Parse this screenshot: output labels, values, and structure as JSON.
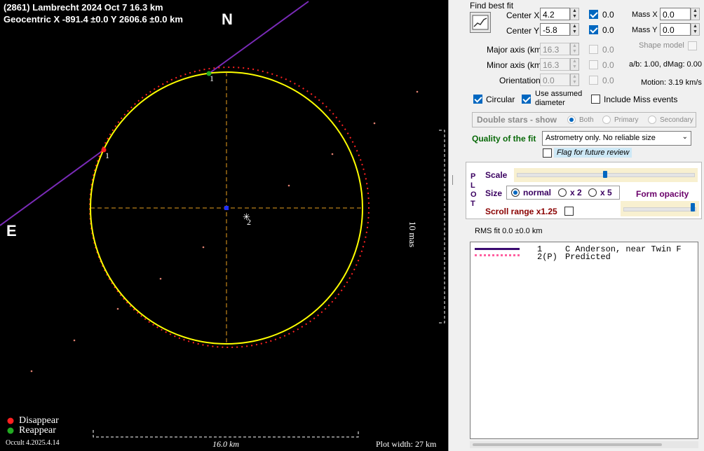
{
  "plot": {
    "title_line1": "(2861) Lambrecht  2024 Oct 7  16.3 km",
    "title_line2": "Geocentric  X  -891.4 ±0.0  Y 2606.6 ±0.0 km",
    "north_label": "N",
    "east_label": "E",
    "chord_marker_label": "1",
    "chord_marker_label_2": "1",
    "star_label": "2",
    "legend_disappear": "Disappear",
    "legend_reappear": "Reappear",
    "version": "Occult 4.2025.4.14",
    "scale_bar_label": "16.0 km",
    "plot_width_label": "Plot width: 27 km",
    "side_scale_label": "10 mas",
    "colors": {
      "ellipse": "#ffff00",
      "predicted": "#ff2020",
      "chord": "#7a2bb8",
      "axes": "#e8a020",
      "disappear": "#ff2020",
      "reappear": "#22aa22"
    }
  },
  "panel": {
    "find_best_fit": "Find best fit",
    "center_x_label": "Center X",
    "center_x_value": "4.2",
    "center_x_check": "0.0",
    "center_y_label": "Center Y",
    "center_y_value": "-5.8",
    "center_y_check": "0.0",
    "mass_x_label": "Mass X",
    "mass_x_value": "0.0",
    "mass_y_label": "Mass Y",
    "mass_y_value": "0.0",
    "shape_model_label": "Shape model",
    "major_axis_label": "Major axis (km)",
    "major_axis_value": "16.3",
    "major_axis_check": "0.0",
    "minor_axis_label": "Minor axis (km)",
    "minor_axis_value": "16.3",
    "minor_axis_check": "0.0",
    "orientation_label": "Orientation",
    "orientation_value": "0.0",
    "orientation_check": "0.0",
    "ab_dmag": "a/b: 1.00, dMag: 0.00",
    "motion": "Motion: 3.19 km/s",
    "circular_label": "Circular",
    "use_assumed_label": "Use assumed",
    "use_assumed_label2": "diameter",
    "include_miss_label": "Include Miss events",
    "double_stars_label": "Double stars - show",
    "both_label": "Both",
    "primary_label": "Primary",
    "secondary_label": "Secondary",
    "quality_label": "Quality of the fit",
    "quality_value": "Astrometry only. No reliable size",
    "flag_label": "Flag for future review",
    "plot_letters": [
      "P",
      "L",
      "O",
      "T"
    ],
    "scale_label": "Scale",
    "size_label": "Size",
    "size_normal": "normal",
    "size_x2": "x 2",
    "size_x5": "x 5",
    "form_opacity_label": "Form opacity",
    "scroll_range_label": "Scroll range x1.25",
    "scale_level": 0.5,
    "opacity_level": 1.0,
    "rms_fit": "RMS fit 0.0 ±0.0 km",
    "legend_rows": [
      {
        "index": "1",
        "text": "C Anderson, near Twin F"
      },
      {
        "index": "2(P)",
        "text": "Predicted"
      }
    ]
  }
}
